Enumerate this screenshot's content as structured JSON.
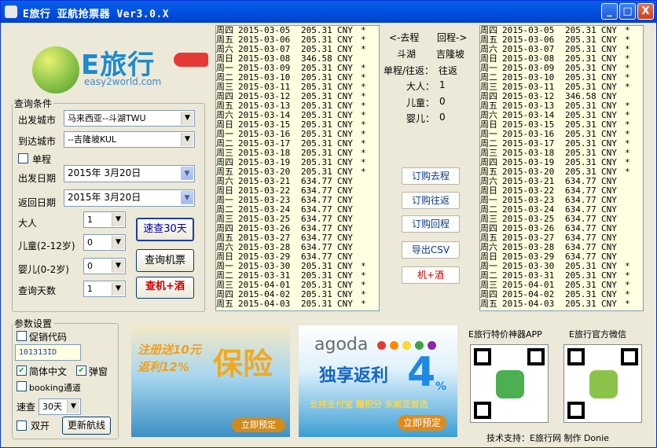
{
  "titlebar": {
    "title": "E旅行  亚航抢票器  Ver3.0.X",
    "min": "_",
    "max": "□",
    "close": "X"
  },
  "logo": {
    "text": "E旅行",
    "sub": "easy2world.com"
  },
  "query": {
    "legend": "查询条件",
    "from_label": "出发城市",
    "from_value": "马来西亚--斗湖TWU",
    "to_label": "到达城市",
    "to_value": "--吉隆坡KUL",
    "oneway_label": "单程",
    "depart_label": "出发日期",
    "depart_value": "2015年 3月20日",
    "return_label": "返回日期",
    "return_value": "2015年 3月20日",
    "adult_label": "大人",
    "adult_value": "1",
    "child_label": "儿童(2-12岁)",
    "child_value": "0",
    "infant_label": "婴儿(0-2岁)",
    "infant_value": "0",
    "days_label": "查询天数",
    "days_value": "1",
    "btn_quick30": "速查30天",
    "btn_search": "查询机票",
    "btn_hotel": "查机+酒"
  },
  "params": {
    "legend": "参数设置",
    "promo_label": "促销代码",
    "promo_value": "101313ID",
    "lang_label": "简体中文",
    "popup_label": "弹窗",
    "booking_label": "booking通道",
    "speed_label": "速查",
    "speed_value": "30天",
    "dual_label": "双开",
    "btn_update": "更新航线"
  },
  "left_list": [
    [
      "周四",
      "2015-03-05",
      "205.31",
      "CNY",
      "*"
    ],
    [
      "周五",
      "2015-03-06",
      "205.31",
      "CNY",
      "*"
    ],
    [
      "周六",
      "2015-03-07",
      "205.31",
      "CNY",
      "*"
    ],
    [
      "周日",
      "2015-03-08",
      "346.58",
      "CNY",
      ""
    ],
    [
      "周一",
      "2015-03-09",
      "205.31",
      "CNY",
      "*"
    ],
    [
      "周二",
      "2015-03-10",
      "205.31",
      "CNY",
      "*"
    ],
    [
      "周三",
      "2015-03-11",
      "205.31",
      "CNY",
      "*"
    ],
    [
      "周四",
      "2015-03-12",
      "205.31",
      "CNY",
      "*"
    ],
    [
      "周五",
      "2015-03-13",
      "205.31",
      "CNY",
      "*"
    ],
    [
      "周六",
      "2015-03-14",
      "205.31",
      "CNY",
      "*"
    ],
    [
      "周日",
      "2015-03-15",
      "205.31",
      "CNY",
      "*"
    ],
    [
      "周一",
      "2015-03-16",
      "205.31",
      "CNY",
      "*"
    ],
    [
      "周二",
      "2015-03-17",
      "205.31",
      "CNY",
      "*"
    ],
    [
      "周三",
      "2015-03-18",
      "205.31",
      "CNY",
      "*"
    ],
    [
      "周四",
      "2015-03-19",
      "205.31",
      "CNY",
      "*"
    ],
    [
      "周五",
      "2015-03-20",
      "205.31",
      "CNY",
      "*"
    ],
    [
      "周六",
      "2015-03-21",
      "634.77",
      "CNY",
      ""
    ],
    [
      "周日",
      "2015-03-22",
      "634.77",
      "CNY",
      ""
    ],
    [
      "周一",
      "2015-03-23",
      "634.77",
      "CNY",
      ""
    ],
    [
      "周二",
      "2015-03-24",
      "634.77",
      "CNY",
      ""
    ],
    [
      "周三",
      "2015-03-25",
      "634.77",
      "CNY",
      ""
    ],
    [
      "周四",
      "2015-03-26",
      "634.77",
      "CNY",
      ""
    ],
    [
      "周五",
      "2015-03-27",
      "634.77",
      "CNY",
      ""
    ],
    [
      "周六",
      "2015-03-28",
      "634.77",
      "CNY",
      ""
    ],
    [
      "周日",
      "2015-03-29",
      "634.77",
      "CNY",
      ""
    ],
    [
      "周一",
      "2015-03-30",
      "205.31",
      "CNY",
      "*"
    ],
    [
      "周二",
      "2015-03-31",
      "205.31",
      "CNY",
      "*"
    ],
    [
      "周三",
      "2015-04-01",
      "205.31",
      "CNY",
      "*"
    ],
    [
      "周四",
      "2015-04-02",
      "205.31",
      "CNY",
      "*"
    ],
    [
      "周五",
      "2015-04-03",
      "205.31",
      "CNY",
      "*"
    ]
  ],
  "right_list": [
    [
      "周四",
      "2015-03-05",
      "205.31",
      "CNY",
      "*"
    ],
    [
      "周五",
      "2015-03-06",
      "205.31",
      "CNY",
      "*"
    ],
    [
      "周六",
      "2015-03-07",
      "205.31",
      "CNY",
      "*"
    ],
    [
      "周日",
      "2015-03-08",
      "205.31",
      "CNY",
      "*"
    ],
    [
      "周一",
      "2015-03-09",
      "205.31",
      "CNY",
      "*"
    ],
    [
      "周二",
      "2015-03-10",
      "205.31",
      "CNY",
      "*"
    ],
    [
      "周三",
      "2015-03-11",
      "205.31",
      "CNY",
      "*"
    ],
    [
      "周四",
      "2015-03-12",
      "346.58",
      "CNY",
      ""
    ],
    [
      "周五",
      "2015-03-13",
      "205.31",
      "CNY",
      "*"
    ],
    [
      "周六",
      "2015-03-14",
      "205.31",
      "CNY",
      "*"
    ],
    [
      "周日",
      "2015-03-15",
      "205.31",
      "CNY",
      "*"
    ],
    [
      "周一",
      "2015-03-16",
      "205.31",
      "CNY",
      "*"
    ],
    [
      "周二",
      "2015-03-17",
      "205.31",
      "CNY",
      "*"
    ],
    [
      "周三",
      "2015-03-18",
      "205.31",
      "CNY",
      "*"
    ],
    [
      "周四",
      "2015-03-19",
      "205.31",
      "CNY",
      "*"
    ],
    [
      "周五",
      "2015-03-20",
      "205.31",
      "CNY",
      "*"
    ],
    [
      "周六",
      "2015-03-21",
      "634.77",
      "CNY",
      ""
    ],
    [
      "周日",
      "2015-03-22",
      "634.77",
      "CNY",
      ""
    ],
    [
      "周一",
      "2015-03-23",
      "634.77",
      "CNY",
      ""
    ],
    [
      "周二",
      "2015-03-24",
      "634.77",
      "CNY",
      ""
    ],
    [
      "周三",
      "2015-03-25",
      "634.77",
      "CNY",
      ""
    ],
    [
      "周四",
      "2015-03-26",
      "634.77",
      "CNY",
      ""
    ],
    [
      "周五",
      "2015-03-27",
      "634.77",
      "CNY",
      ""
    ],
    [
      "周六",
      "2015-03-28",
      "634.77",
      "CNY",
      ""
    ],
    [
      "周日",
      "2015-03-29",
      "634.77",
      "CNY",
      ""
    ],
    [
      "周一",
      "2015-03-30",
      "205.31",
      "CNY",
      "*"
    ],
    [
      "周二",
      "2015-03-31",
      "205.31",
      "CNY",
      "*"
    ],
    [
      "周三",
      "2015-04-01",
      "205.31",
      "CNY",
      "*"
    ],
    [
      "周四",
      "2015-04-02",
      "205.31",
      "CNY",
      "*"
    ],
    [
      "周五",
      "2015-04-03",
      "205.31",
      "CNY",
      "*"
    ]
  ],
  "middle": {
    "outbound": "<-去程",
    "return": "回程->",
    "from": "斗湖",
    "to": "吉隆坡",
    "trip_label": "单程/往返：",
    "trip_value": "往返",
    "adult_label": "大人：",
    "adult_value": "1",
    "child_label": "儿童：",
    "child_value": "0",
    "infant_label": "婴儿：",
    "infant_value": "0",
    "btn_book_out": "订购去程",
    "btn_book_round": "订购往返",
    "btn_book_return": "订购回程",
    "btn_export": "导出CSV",
    "btn_hotel": "机+酒"
  },
  "ads": {
    "insurance_line1": "注册送10元",
    "insurance_line2": "返利12%",
    "insurance_big": "保险",
    "insurance_cta": "立即预定",
    "agoda_brand": "agoda",
    "agoda_line1": "独享返利",
    "agoda_pct": "4",
    "agoda_pct_sign": "%",
    "agoda_line2": "支持支付宝 赚积分 东南亚首选",
    "agoda_cta": "立即预定"
  },
  "qr": {
    "app_label": "E旅行特价神器APP",
    "wechat_label": "E旅行官方微信"
  },
  "footer": "技术支持：E旅行网 制作 Donie",
  "colors": {
    "accent": "#0054e3",
    "hotel_red": "#d00000",
    "list_bg": "#ffffe1"
  }
}
